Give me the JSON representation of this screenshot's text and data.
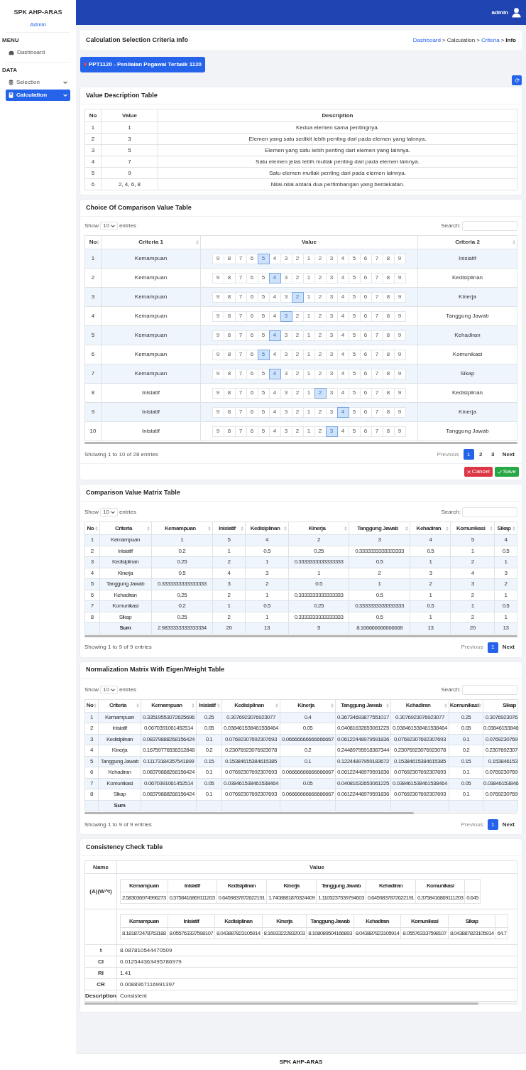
{
  "sidebar": {
    "brand": "SPK AHP-ARAS",
    "role": "Admin",
    "sections": [
      {
        "heading": "MENU",
        "items": [
          {
            "label": "Dashboard",
            "kind": "link",
            "selected": false
          }
        ]
      },
      {
        "heading": "DATA",
        "items": [
          {
            "label": "Selection",
            "kind": "dropdown",
            "selected": false
          },
          {
            "label": "Calculation",
            "kind": "dropdown",
            "selected": true
          }
        ]
      }
    ]
  },
  "topbar": {
    "user": "admin"
  },
  "page": {
    "title": "Calculation Selection Criteria Info",
    "breadcrumb": [
      {
        "label": "Dashboard",
        "kind": "link"
      },
      {
        "label": "Calculation",
        "kind": "text",
        "separator": ">"
      },
      {
        "label": "Criteria",
        "kind": "link",
        "separator": ">"
      },
      {
        "label": "Info",
        "kind": "current",
        "separator": ">"
      }
    ]
  },
  "selection_badge": "PPT1120 - Penilaian Pegawai Terbaik 1120",
  "value_description": {
    "title": "Value Description Table",
    "columns": [
      "No",
      "Value",
      "Description"
    ],
    "rows": [
      [
        "1",
        "1",
        "Kedua elemen sama pentingnya."
      ],
      [
        "2",
        "3",
        "Elemen yang satu sedikit lebih penting dari pada elemen yang lainnya."
      ],
      [
        "3",
        "5",
        "Elemen yang satu lebih penting dari elemen yang lainnya."
      ],
      [
        "4",
        "7",
        "Satu elemen jelas lebih mutlak penting dari pada elemen lainnya."
      ],
      [
        "5",
        "9",
        "Satu elemen mutlak penting dari pada elemen lainnya."
      ],
      [
        "6",
        "2, 4, 6, 8",
        "Nilai-nilai antara dua pertimbangan yang berdekatan."
      ]
    ]
  },
  "choice": {
    "title": "Choice Of Comparison Value Table",
    "show_label": "Show",
    "length": "10",
    "entries_label": "entries",
    "search_label": "Search:",
    "columns": [
      {
        "label": "No",
        "sortable": true
      },
      {
        "label": "Criteria 1",
        "sortable": true
      },
      {
        "label": "Value",
        "sortable": false
      },
      {
        "label": "Criteria 2",
        "sortable": true
      }
    ],
    "rows": [
      {
        "no": "1",
        "criteria_1": "Kemampuan",
        "criteria_2": "Inisiatif",
        "options": [
          {
            "label": "9",
            "selected": false
          },
          {
            "label": "8",
            "selected": false
          },
          {
            "label": "7",
            "selected": false
          },
          {
            "label": "6",
            "selected": false
          },
          {
            "label": "5",
            "selected": true
          },
          {
            "label": "4",
            "selected": false
          },
          {
            "label": "3",
            "selected": false
          },
          {
            "label": "2",
            "selected": false
          },
          {
            "label": "1",
            "selected": false
          },
          {
            "label": "2",
            "selected": false
          },
          {
            "label": "3",
            "selected": false
          },
          {
            "label": "4",
            "selected": false
          },
          {
            "label": "5",
            "selected": false
          },
          {
            "label": "6",
            "selected": false
          },
          {
            "label": "7",
            "selected": false
          },
          {
            "label": "8",
            "selected": false
          },
          {
            "label": "9",
            "selected": false
          }
        ]
      },
      {
        "no": "2",
        "criteria_1": "Kemampuan",
        "criteria_2": "Kedisiplinan",
        "options": [
          {
            "label": "9",
            "selected": false
          },
          {
            "label": "8",
            "selected": false
          },
          {
            "label": "7",
            "selected": false
          },
          {
            "label": "6",
            "selected": false
          },
          {
            "label": "5",
            "selected": false
          },
          {
            "label": "4",
            "selected": true
          },
          {
            "label": "3",
            "selected": false
          },
          {
            "label": "2",
            "selected": false
          },
          {
            "label": "1",
            "selected": false
          },
          {
            "label": "2",
            "selected": false
          },
          {
            "label": "3",
            "selected": false
          },
          {
            "label": "4",
            "selected": false
          },
          {
            "label": "5",
            "selected": false
          },
          {
            "label": "6",
            "selected": false
          },
          {
            "label": "7",
            "selected": false
          },
          {
            "label": "8",
            "selected": false
          },
          {
            "label": "9",
            "selected": false
          }
        ]
      },
      {
        "no": "3",
        "criteria_1": "Kemampuan",
        "criteria_2": "Kinerja",
        "options": [
          {
            "label": "9",
            "selected": false
          },
          {
            "label": "8",
            "selected": false
          },
          {
            "label": "7",
            "selected": false
          },
          {
            "label": "6",
            "selected": false
          },
          {
            "label": "5",
            "selected": false
          },
          {
            "label": "4",
            "selected": false
          },
          {
            "label": "3",
            "selected": false
          },
          {
            "label": "2",
            "selected": true
          },
          {
            "label": "1",
            "selected": false
          },
          {
            "label": "2",
            "selected": false
          },
          {
            "label": "3",
            "selected": false
          },
          {
            "label": "4",
            "selected": false
          },
          {
            "label": "5",
            "selected": false
          },
          {
            "label": "6",
            "selected": false
          },
          {
            "label": "7",
            "selected": false
          },
          {
            "label": "8",
            "selected": false
          },
          {
            "label": "9",
            "selected": false
          }
        ]
      },
      {
        "no": "4",
        "criteria_1": "Kemampuan",
        "criteria_2": "Tanggung Jawab",
        "options": [
          {
            "label": "9",
            "selected": false
          },
          {
            "label": "8",
            "selected": false
          },
          {
            "label": "7",
            "selected": false
          },
          {
            "label": "6",
            "selected": false
          },
          {
            "label": "5",
            "selected": false
          },
          {
            "label": "4",
            "selected": false
          },
          {
            "label": "3",
            "selected": true
          },
          {
            "label": "2",
            "selected": false
          },
          {
            "label": "1",
            "selected": false
          },
          {
            "label": "2",
            "selected": false
          },
          {
            "label": "3",
            "selected": false
          },
          {
            "label": "4",
            "selected": false
          },
          {
            "label": "5",
            "selected": false
          },
          {
            "label": "6",
            "selected": false
          },
          {
            "label": "7",
            "selected": false
          },
          {
            "label": "8",
            "selected": false
          },
          {
            "label": "9",
            "selected": false
          }
        ]
      },
      {
        "no": "5",
        "criteria_1": "Kemampuan",
        "criteria_2": "Kehadiran",
        "options": [
          {
            "label": "9",
            "selected": false
          },
          {
            "label": "8",
            "selected": false
          },
          {
            "label": "7",
            "selected": false
          },
          {
            "label": "6",
            "selected": false
          },
          {
            "label": "5",
            "selected": false
          },
          {
            "label": "4",
            "selected": true
          },
          {
            "label": "3",
            "selected": false
          },
          {
            "label": "2",
            "selected": false
          },
          {
            "label": "1",
            "selected": false
          },
          {
            "label": "2",
            "selected": false
          },
          {
            "label": "3",
            "selected": false
          },
          {
            "label": "4",
            "selected": false
          },
          {
            "label": "5",
            "selected": false
          },
          {
            "label": "6",
            "selected": false
          },
          {
            "label": "7",
            "selected": false
          },
          {
            "label": "8",
            "selected": false
          },
          {
            "label": "9",
            "selected": false
          }
        ]
      },
      {
        "no": "6",
        "criteria_1": "Kemampuan",
        "criteria_2": "Komunikasi",
        "options": [
          {
            "label": "9",
            "selected": false
          },
          {
            "label": "8",
            "selected": false
          },
          {
            "label": "7",
            "selected": false
          },
          {
            "label": "6",
            "selected": false
          },
          {
            "label": "5",
            "selected": true
          },
          {
            "label": "4",
            "selected": false
          },
          {
            "label": "3",
            "selected": false
          },
          {
            "label": "2",
            "selected": false
          },
          {
            "label": "1",
            "selected": false
          },
          {
            "label": "2",
            "selected": false
          },
          {
            "label": "3",
            "selected": false
          },
          {
            "label": "4",
            "selected": false
          },
          {
            "label": "5",
            "selected": false
          },
          {
            "label": "6",
            "selected": false
          },
          {
            "label": "7",
            "selected": false
          },
          {
            "label": "8",
            "selected": false
          },
          {
            "label": "9",
            "selected": false
          }
        ]
      },
      {
        "no": "7",
        "criteria_1": "Kemampuan",
        "criteria_2": "Sikap",
        "options": [
          {
            "label": "9",
            "selected": false
          },
          {
            "label": "8",
            "selected": false
          },
          {
            "label": "7",
            "selected": false
          },
          {
            "label": "6",
            "selected": false
          },
          {
            "label": "5",
            "selected": false
          },
          {
            "label": "4",
            "selected": true
          },
          {
            "label": "3",
            "selected": false
          },
          {
            "label": "2",
            "selected": false
          },
          {
            "label": "1",
            "selected": false
          },
          {
            "label": "2",
            "selected": false
          },
          {
            "label": "3",
            "selected": false
          },
          {
            "label": "4",
            "selected": false
          },
          {
            "label": "5",
            "selected": false
          },
          {
            "label": "6",
            "selected": false
          },
          {
            "label": "7",
            "selected": false
          },
          {
            "label": "8",
            "selected": false
          },
          {
            "label": "9",
            "selected": false
          }
        ]
      },
      {
        "no": "8",
        "criteria_1": "Inisiatif",
        "criteria_2": "Kedisiplinan",
        "options": [
          {
            "label": "9",
            "selected": false
          },
          {
            "label": "8",
            "selected": false
          },
          {
            "label": "7",
            "selected": false
          },
          {
            "label": "6",
            "selected": false
          },
          {
            "label": "5",
            "selected": false
          },
          {
            "label": "4",
            "selected": false
          },
          {
            "label": "3",
            "selected": false
          },
          {
            "label": "2",
            "selected": false
          },
          {
            "label": "1",
            "selected": false
          },
          {
            "label": "2",
            "selected": true
          },
          {
            "label": "3",
            "selected": false
          },
          {
            "label": "4",
            "selected": false
          },
          {
            "label": "5",
            "selected": false
          },
          {
            "label": "6",
            "selected": false
          },
          {
            "label": "7",
            "selected": false
          },
          {
            "label": "8",
            "selected": false
          },
          {
            "label": "9",
            "selected": false
          }
        ]
      },
      {
        "no": "9",
        "criteria_1": "Inisiatif",
        "criteria_2": "Kinerja",
        "options": [
          {
            "label": "9",
            "selected": false
          },
          {
            "label": "8",
            "selected": false
          },
          {
            "label": "7",
            "selected": false
          },
          {
            "label": "6",
            "selected": false
          },
          {
            "label": "5",
            "selected": false
          },
          {
            "label": "4",
            "selected": false
          },
          {
            "label": "3",
            "selected": false
          },
          {
            "label": "2",
            "selected": false
          },
          {
            "label": "1",
            "selected": false
          },
          {
            "label": "2",
            "selected": false
          },
          {
            "label": "3",
            "selected": false
          },
          {
            "label": "4",
            "selected": true
          },
          {
            "label": "5",
            "selected": false
          },
          {
            "label": "6",
            "selected": false
          },
          {
            "label": "7",
            "selected": false
          },
          {
            "label": "8",
            "selected": false
          },
          {
            "label": "9",
            "selected": false
          }
        ]
      },
      {
        "no": "10",
        "criteria_1": "Inisiatif",
        "criteria_2": "Tanggung Jawab",
        "options": [
          {
            "label": "9",
            "selected": false
          },
          {
            "label": "8",
            "selected": false
          },
          {
            "label": "7",
            "selected": false
          },
          {
            "label": "6",
            "selected": false
          },
          {
            "label": "5",
            "selected": false
          },
          {
            "label": "4",
            "selected": false
          },
          {
            "label": "3",
            "selected": false
          },
          {
            "label": "2",
            "selected": false
          },
          {
            "label": "1",
            "selected": false
          },
          {
            "label": "2",
            "selected": false
          },
          {
            "label": "3",
            "selected": true
          },
          {
            "label": "4",
            "selected": false
          },
          {
            "label": "5",
            "selected": false
          },
          {
            "label": "6",
            "selected": false
          },
          {
            "label": "7",
            "selected": false
          },
          {
            "label": "8",
            "selected": false
          },
          {
            "label": "9",
            "selected": false
          }
        ]
      }
    ],
    "info": "Showing 1 to 10 of 28 entries",
    "pagination": [
      {
        "label": "Previous",
        "selected": false
      },
      {
        "label": "1",
        "selected": true
      },
      {
        "label": "2",
        "selected": false
      },
      {
        "label": "3",
        "selected": false
      },
      {
        "label": "Next",
        "selected": false
      }
    ],
    "actions": [
      {
        "label": "Cancel",
        "kind": "cancel"
      },
      {
        "label": "Save",
        "kind": "save"
      }
    ]
  },
  "matrix": {
    "title": "Comparison Value Matrix Table",
    "show_label": "Show",
    "length": "10",
    "entries_label": "entries",
    "search_label": "Search:",
    "columns": [
      "No",
      "Criteria",
      "Kemampuan",
      "Inisiatif",
      "Kedisiplinan",
      "Kinerja",
      "Tanggung Jawab",
      "Kehadiran",
      "Komunikasi",
      "Sikap"
    ],
    "rows": [
      [
        "1",
        "Kemampuan",
        "1",
        "5",
        "4",
        "2",
        "3",
        "4",
        "5",
        "4"
      ],
      [
        "2",
        "Inisiatif",
        "0.2",
        "1",
        "0.5",
        "0.25",
        "0.3333333333333333",
        "0.5",
        "1",
        "0.5"
      ],
      [
        "3",
        "Kedisiplinan",
        "0.25",
        "2",
        "1",
        "0.3333333333333333",
        "0.5",
        "1",
        "2",
        "1"
      ],
      [
        "4",
        "Kinerja",
        "0.5",
        "4",
        "3",
        "1",
        "2",
        "3",
        "4",
        "3"
      ],
      [
        "5",
        "Tanggung Jawab",
        "0.3333333333333333",
        "3",
        "2",
        "0.5",
        "1",
        "2",
        "3",
        "2"
      ],
      [
        "6",
        "Kehadiran",
        "0.25",
        "2",
        "1",
        "0.3333333333333333",
        "0.5",
        "1",
        "2",
        "1"
      ],
      [
        "7",
        "Komunikasi",
        "0.2",
        "1",
        "0.5",
        "0.25",
        "0.3333333333333333",
        "0.5",
        "1",
        "0.5"
      ],
      [
        "8",
        "Sikap",
        "0.25",
        "2",
        "1",
        "0.3333333333333333",
        "0.5",
        "1",
        "2",
        "1"
      ]
    ],
    "footer": {
      "label": "Sum",
      "values": [
        "2.9833333333333334",
        "20",
        "13",
        "5",
        "8.166666666666668",
        "13",
        "20",
        "13"
      ]
    },
    "info": "Showing 1 to 9 of 9 entries",
    "pagination": [
      {
        "label": "Previous",
        "selected": false
      },
      {
        "label": "1",
        "selected": true
      },
      {
        "label": "Next",
        "selected": false
      }
    ]
  },
  "normalization": {
    "title": "Normalization Matrix With Eigen/Weight Table",
    "show_label": "Show",
    "length": "10",
    "entries_label": "entries",
    "search_label": "Search:",
    "columns": [
      "No",
      "Criteria",
      "Kemampuan",
      "Inisiatif",
      "Kedisiplinan",
      "Kinerja",
      "Tanggung Jawab",
      "Kehadiran",
      "Komunikasi",
      "Sikap"
    ],
    "rows": [
      [
        "1",
        "Kemampuan",
        "0.33519553072625696",
        "0.25",
        "0.3076923076923077",
        "0.4",
        "0.36734693877551017",
        "0.3076923076923077",
        "0.25",
        "0.3076923076"
      ],
      [
        "2",
        "Inisiatif",
        "0.0670391061452514",
        "0.05",
        "0.038461538461538464",
        "0.05",
        "0.04081632653061225",
        "0.038461538461538464",
        "0.05",
        "0.03846153846"
      ],
      [
        "3",
        "Kedisiplinan",
        "0.08379888268156424",
        "0.1",
        "0.07692307692307693",
        "0.06666666666666667",
        "0.06122448979591836",
        "0.07692307692307693",
        "0.1",
        "0.0769230769"
      ],
      [
        "4",
        "Kinerja",
        "0.16759776536312848",
        "0.2",
        "0.23076923076923078",
        "0.2",
        "0.24489795918367344",
        "0.23076923076923078",
        "0.2",
        "0.2307692307"
      ],
      [
        "5",
        "Tanggung Jawab",
        "0.11173184357541899",
        "0.15",
        "0.15384615384615385",
        "0.1",
        "0.12244897959183672",
        "0.15384615384615385",
        "0.15",
        "0.153846153"
      ],
      [
        "6",
        "Kehadiran",
        "0.08379888268156424",
        "0.1",
        "0.07692307692307693",
        "0.06666666666666667",
        "0.06122448979591836",
        "0.07692307692307693",
        "0.1",
        "0.0769230769"
      ],
      [
        "7",
        "Komunikasi",
        "0.0670391061452514",
        "0.05",
        "0.038461538461538464",
        "0.05",
        "0.04081632653061225",
        "0.038461538461538464",
        "0.05",
        "0.03846153846"
      ],
      [
        "8",
        "Sikap",
        "0.08379888268156424",
        "0.1",
        "0.07692307692307693",
        "0.06666666666666667",
        "0.06122448979591836",
        "0.07692307692307693",
        "0.1",
        "0.0769230769"
      ]
    ],
    "footer": {
      "label": "Sum"
    },
    "info": "Showing 1 to 9 of 9 entries",
    "pagination": [
      {
        "label": "Previous",
        "selected": false
      },
      {
        "label": "1",
        "selected": true
      },
      {
        "label": "Next",
        "selected": false
      }
    ]
  },
  "consistency": {
    "title": "Consistency Check Table",
    "columns": [
      "Name",
      "Value"
    ],
    "rows": [
      {
        "kind": "nested",
        "name": "(A)(W^t)",
        "columns": [
          "Kemampuan",
          "Inisiatif",
          "Kedisiplinan",
          "Kinerja",
          "Tanggung Jawab",
          "Kehadiran",
          "Komunikasi"
        ],
        "values": [
          "2.583036974996273",
          "0.3758416869111203",
          "0.6459837872622191",
          "1.7408881870324409",
          "1.1105237539794603",
          "0.6459837872622191",
          "0.3758416869111203",
          "0.645"
        ]
      },
      {
        "kind": "nested",
        "columns": [
          "Kemampuan",
          "Inisiatif",
          "Kedisiplinan",
          "Kinerja",
          "Tanggung Jawab",
          "Kehadiran",
          "Komunikasi",
          "Sikap"
        ],
        "values": [
          "8.181872478763188",
          "8.055763337598107",
          "8.043887823105914",
          "8.16933222832003",
          "8.108089504166893",
          "8.043887823105914",
          "8.055763337598107",
          "8.043887823105914",
          "64.7"
        ]
      },
      {
        "kind": "text",
        "name": "t",
        "value": "8.087810544470509"
      },
      {
        "kind": "text",
        "name": "CI",
        "value": "0.012544363495786979"
      },
      {
        "kind": "text",
        "name": "RI",
        "value": "1.41"
      },
      {
        "kind": "text",
        "name": "CR",
        "value": "0.0088967116991397"
      },
      {
        "kind": "text",
        "name": "Description",
        "value": "Consistent"
      }
    ]
  },
  "footer": "SPK AHP-ARAS"
}
